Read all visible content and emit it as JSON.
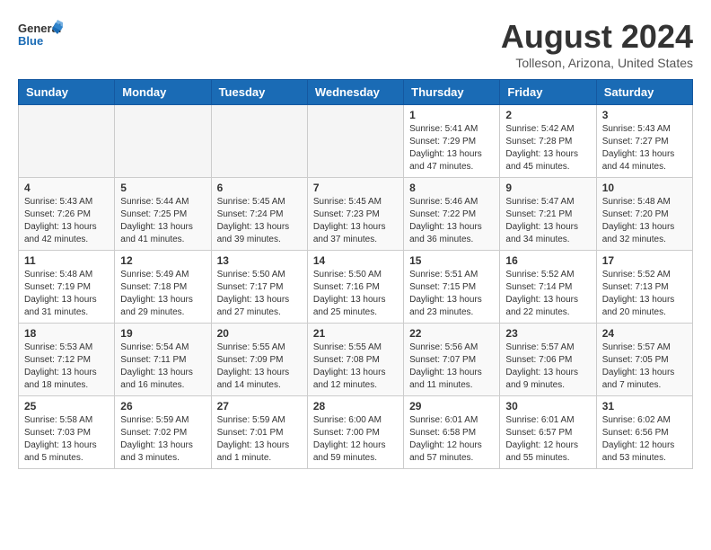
{
  "logo": {
    "general": "General",
    "blue": "Blue"
  },
  "title": "August 2024",
  "subtitle": "Tolleson, Arizona, United States",
  "weekdays": [
    "Sunday",
    "Monday",
    "Tuesday",
    "Wednesday",
    "Thursday",
    "Friday",
    "Saturday"
  ],
  "weeks": [
    [
      {
        "day": "",
        "info": ""
      },
      {
        "day": "",
        "info": ""
      },
      {
        "day": "",
        "info": ""
      },
      {
        "day": "",
        "info": ""
      },
      {
        "day": "1",
        "info": "Sunrise: 5:41 AM\nSunset: 7:29 PM\nDaylight: 13 hours\nand 47 minutes."
      },
      {
        "day": "2",
        "info": "Sunrise: 5:42 AM\nSunset: 7:28 PM\nDaylight: 13 hours\nand 45 minutes."
      },
      {
        "day": "3",
        "info": "Sunrise: 5:43 AM\nSunset: 7:27 PM\nDaylight: 13 hours\nand 44 minutes."
      }
    ],
    [
      {
        "day": "4",
        "info": "Sunrise: 5:43 AM\nSunset: 7:26 PM\nDaylight: 13 hours\nand 42 minutes."
      },
      {
        "day": "5",
        "info": "Sunrise: 5:44 AM\nSunset: 7:25 PM\nDaylight: 13 hours\nand 41 minutes."
      },
      {
        "day": "6",
        "info": "Sunrise: 5:45 AM\nSunset: 7:24 PM\nDaylight: 13 hours\nand 39 minutes."
      },
      {
        "day": "7",
        "info": "Sunrise: 5:45 AM\nSunset: 7:23 PM\nDaylight: 13 hours\nand 37 minutes."
      },
      {
        "day": "8",
        "info": "Sunrise: 5:46 AM\nSunset: 7:22 PM\nDaylight: 13 hours\nand 36 minutes."
      },
      {
        "day": "9",
        "info": "Sunrise: 5:47 AM\nSunset: 7:21 PM\nDaylight: 13 hours\nand 34 minutes."
      },
      {
        "day": "10",
        "info": "Sunrise: 5:48 AM\nSunset: 7:20 PM\nDaylight: 13 hours\nand 32 minutes."
      }
    ],
    [
      {
        "day": "11",
        "info": "Sunrise: 5:48 AM\nSunset: 7:19 PM\nDaylight: 13 hours\nand 31 minutes."
      },
      {
        "day": "12",
        "info": "Sunrise: 5:49 AM\nSunset: 7:18 PM\nDaylight: 13 hours\nand 29 minutes."
      },
      {
        "day": "13",
        "info": "Sunrise: 5:50 AM\nSunset: 7:17 PM\nDaylight: 13 hours\nand 27 minutes."
      },
      {
        "day": "14",
        "info": "Sunrise: 5:50 AM\nSunset: 7:16 PM\nDaylight: 13 hours\nand 25 minutes."
      },
      {
        "day": "15",
        "info": "Sunrise: 5:51 AM\nSunset: 7:15 PM\nDaylight: 13 hours\nand 23 minutes."
      },
      {
        "day": "16",
        "info": "Sunrise: 5:52 AM\nSunset: 7:14 PM\nDaylight: 13 hours\nand 22 minutes."
      },
      {
        "day": "17",
        "info": "Sunrise: 5:52 AM\nSunset: 7:13 PM\nDaylight: 13 hours\nand 20 minutes."
      }
    ],
    [
      {
        "day": "18",
        "info": "Sunrise: 5:53 AM\nSunset: 7:12 PM\nDaylight: 13 hours\nand 18 minutes."
      },
      {
        "day": "19",
        "info": "Sunrise: 5:54 AM\nSunset: 7:11 PM\nDaylight: 13 hours\nand 16 minutes."
      },
      {
        "day": "20",
        "info": "Sunrise: 5:55 AM\nSunset: 7:09 PM\nDaylight: 13 hours\nand 14 minutes."
      },
      {
        "day": "21",
        "info": "Sunrise: 5:55 AM\nSunset: 7:08 PM\nDaylight: 13 hours\nand 12 minutes."
      },
      {
        "day": "22",
        "info": "Sunrise: 5:56 AM\nSunset: 7:07 PM\nDaylight: 13 hours\nand 11 minutes."
      },
      {
        "day": "23",
        "info": "Sunrise: 5:57 AM\nSunset: 7:06 PM\nDaylight: 13 hours\nand 9 minutes."
      },
      {
        "day": "24",
        "info": "Sunrise: 5:57 AM\nSunset: 7:05 PM\nDaylight: 13 hours\nand 7 minutes."
      }
    ],
    [
      {
        "day": "25",
        "info": "Sunrise: 5:58 AM\nSunset: 7:03 PM\nDaylight: 13 hours\nand 5 minutes."
      },
      {
        "day": "26",
        "info": "Sunrise: 5:59 AM\nSunset: 7:02 PM\nDaylight: 13 hours\nand 3 minutes."
      },
      {
        "day": "27",
        "info": "Sunrise: 5:59 AM\nSunset: 7:01 PM\nDaylight: 13 hours\nand 1 minute."
      },
      {
        "day": "28",
        "info": "Sunrise: 6:00 AM\nSunset: 7:00 PM\nDaylight: 12 hours\nand 59 minutes."
      },
      {
        "day": "29",
        "info": "Sunrise: 6:01 AM\nSunset: 6:58 PM\nDaylight: 12 hours\nand 57 minutes."
      },
      {
        "day": "30",
        "info": "Sunrise: 6:01 AM\nSunset: 6:57 PM\nDaylight: 12 hours\nand 55 minutes."
      },
      {
        "day": "31",
        "info": "Sunrise: 6:02 AM\nSunset: 6:56 PM\nDaylight: 12 hours\nand 53 minutes."
      }
    ]
  ]
}
